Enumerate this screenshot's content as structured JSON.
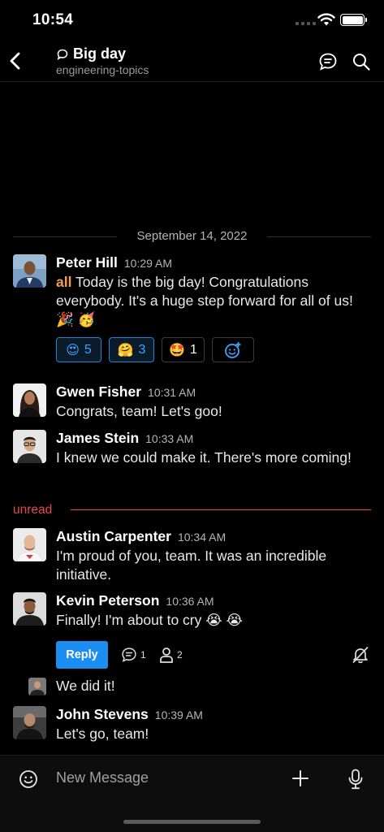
{
  "status_bar": {
    "time": "10:54"
  },
  "header": {
    "title": "Big day",
    "channel": "engineering-topics"
  },
  "date_divider": "September 14, 2022",
  "messages": [
    {
      "author": "Peter Hill",
      "time": "10:29 AM",
      "mention": "all",
      "text": " Today is the big day! Congratulations everybody. It's a huge step forward for all of us! 🎉 🥳",
      "reactions": [
        {
          "emoji": "😍",
          "count": "5",
          "active": true
        },
        {
          "emoji": "🤗",
          "count": "3",
          "active": true
        },
        {
          "emoji": "🤩",
          "count": "1",
          "active": false
        }
      ]
    },
    {
      "author": "Gwen Fisher",
      "time": "10:31 AM",
      "text": "Congrats, team! Let's goo!"
    },
    {
      "author": "James Stein",
      "time": "10:33 AM",
      "text": "I knew we could make it. There's more coming!"
    },
    {
      "author": "Austin Carpenter",
      "time": "10:34 AM",
      "text": "I'm proud of you, team. It was an incredible initiative."
    },
    {
      "author": "Kevin Peterson",
      "time": "10:36 AM",
      "text": "Finally! I'm about to cry 😭 😭",
      "thread": {
        "reply_label": "Reply",
        "reply_count": "1",
        "follower_count": "2"
      }
    },
    {
      "author": "",
      "time": "",
      "text": "We did it!"
    },
    {
      "author": "John Stevens",
      "time": "10:39 AM",
      "text": "Let's go, team!"
    }
  ],
  "unread_label": "unread",
  "composer": {
    "placeholder": "New Message"
  },
  "colors": {
    "accent": "#1c8ef2",
    "mention": "#f39c4a",
    "unread": "#e5484d"
  }
}
